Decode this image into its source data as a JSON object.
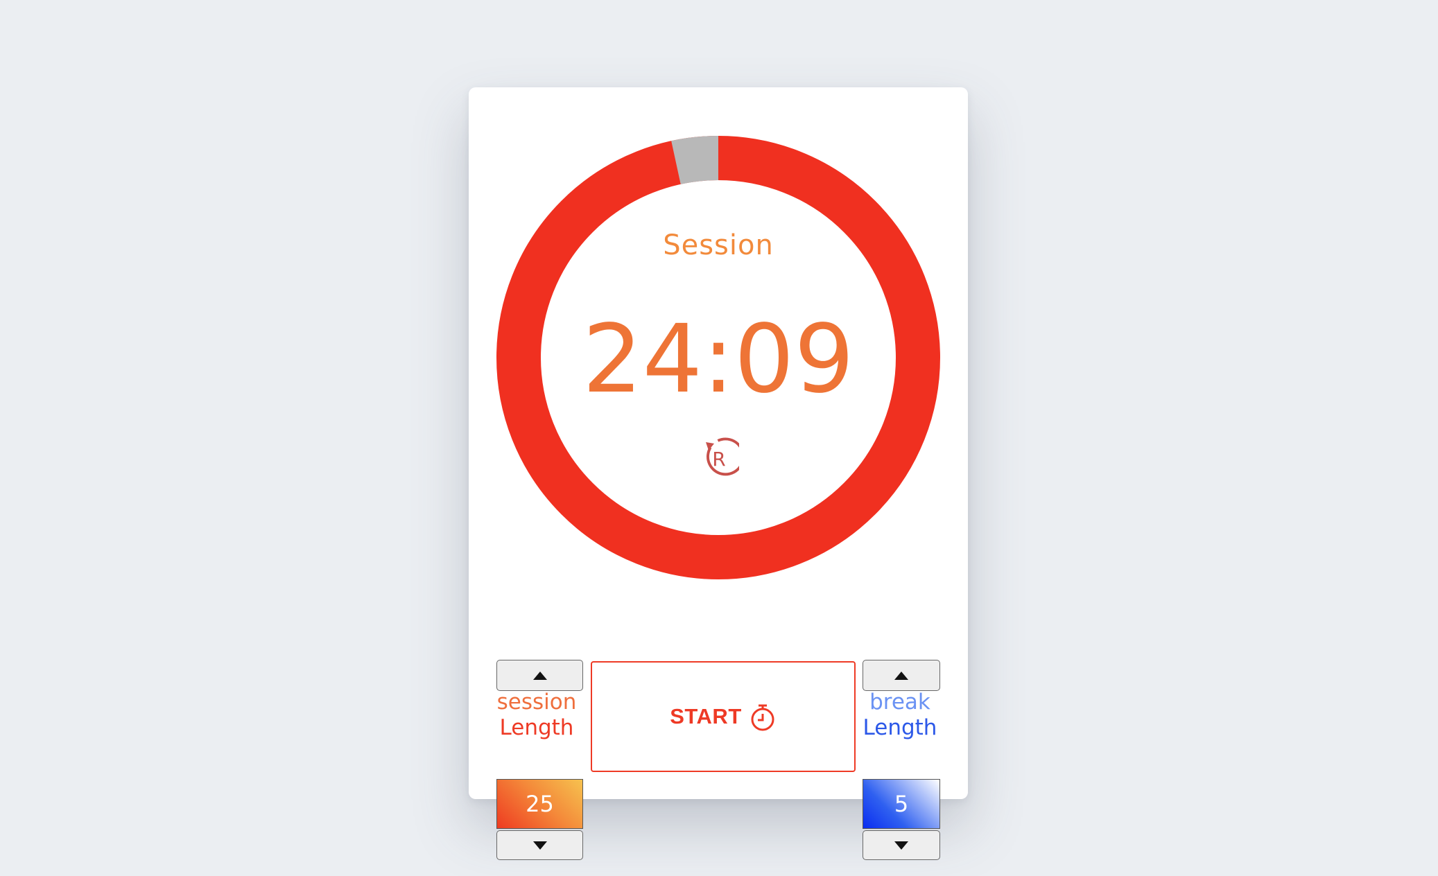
{
  "timer": {
    "mode_label": "Session",
    "time_display": "24:09",
    "progress_fraction": 0.034,
    "colors": {
      "ring": "#f03020",
      "elapsed": "#b8b8b8"
    }
  },
  "session_length": {
    "label_top": "session",
    "label_bottom": "Length",
    "value": "25"
  },
  "break_length": {
    "label_top": "break",
    "label_bottom": "Length",
    "value": "5"
  },
  "controls": {
    "start_label": "START",
    "icons": {
      "reset": "reset-icon",
      "start": "stopwatch-icon",
      "increment": "triangle-up-icon",
      "decrement": "triangle-down-icon"
    }
  }
}
